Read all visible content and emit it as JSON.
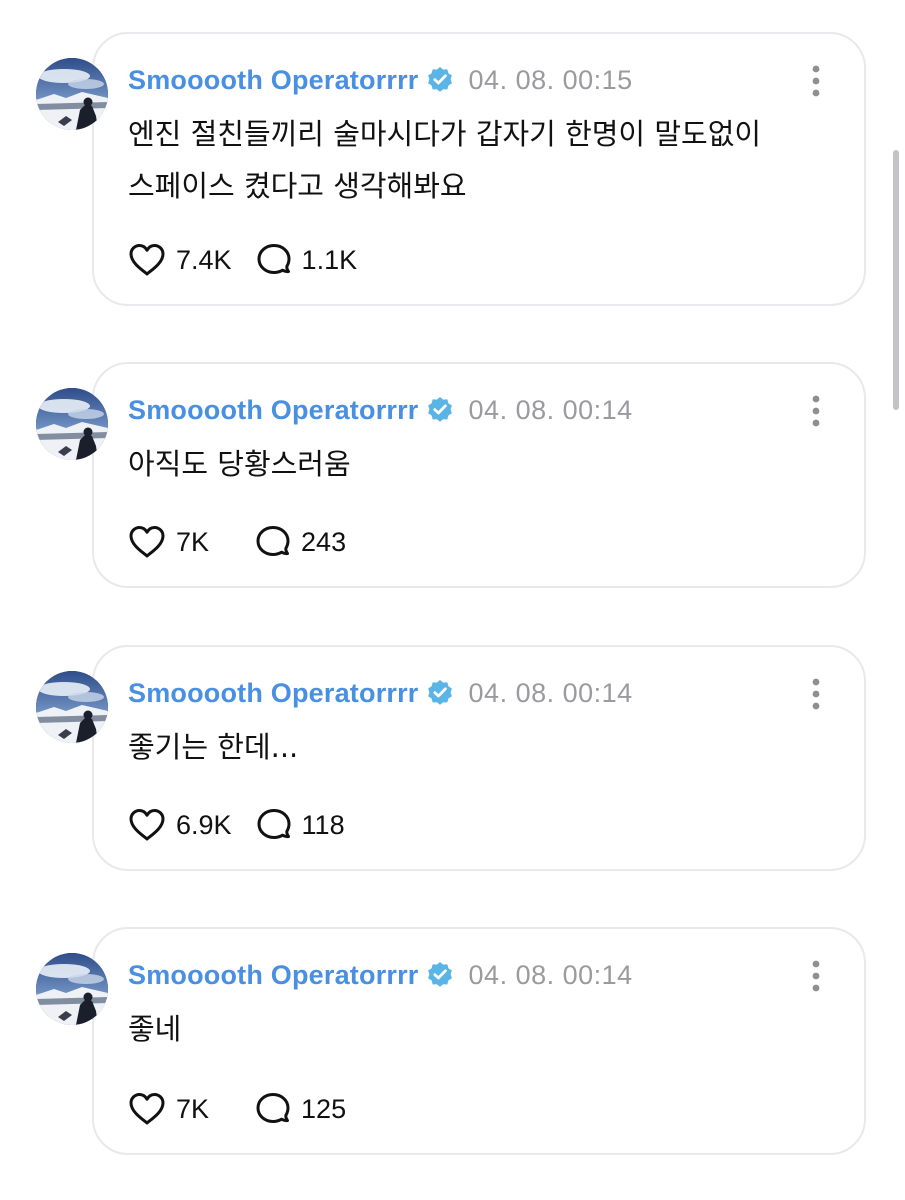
{
  "posts": [
    {
      "username": "Smooooth Operatorrrr",
      "timestamp": "04. 08. 00:15",
      "text_lines": [
        "엔진 절친들끼리 술마시다가 갑자기 한명이 말도없이",
        "스페이스 켰다고 생각해봐요"
      ],
      "likes": "7.4K",
      "comments": "1.1K"
    },
    {
      "username": "Smooooth Operatorrrr",
      "timestamp": "04. 08. 00:14",
      "text_lines": [
        "아직도 당황스러움"
      ],
      "likes": "7K",
      "comments": "243"
    },
    {
      "username": "Smooooth Operatorrrr",
      "timestamp": "04. 08. 00:14",
      "text_lines": [
        "좋기는 한데..."
      ],
      "likes": "6.9K",
      "comments": "118"
    },
    {
      "username": "Smooooth Operatorrrr",
      "timestamp": "04. 08. 00:14",
      "text_lines": [
        "좋네"
      ],
      "likes": "7K",
      "comments": "125"
    }
  ],
  "icons": {
    "verified": "verified-badge-icon",
    "more": "more-vertical-icon",
    "like": "heart-icon",
    "comment": "comment-bubble-icon"
  },
  "colors": {
    "username": "#4a90e2",
    "verified_badge": "#5ab4e6",
    "timestamp": "#9a9a9f",
    "card_border": "#e9e9ed"
  }
}
